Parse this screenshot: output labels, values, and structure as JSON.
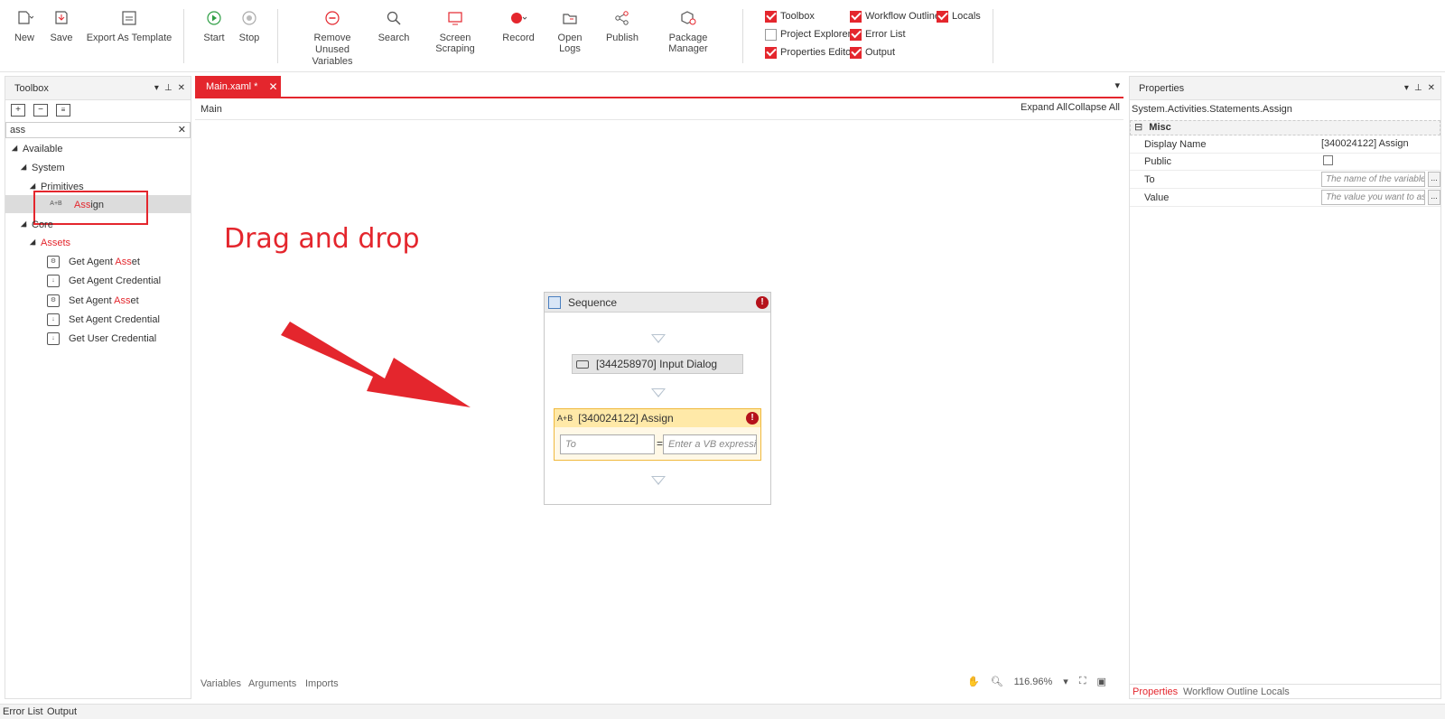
{
  "ribbon": {
    "buttons": [
      {
        "label": "New",
        "icon": "new-file-icon"
      },
      {
        "label": "Save",
        "icon": "save-icon"
      },
      {
        "label": "Export As Template",
        "icon": "export-template-icon"
      },
      {
        "label": "Start",
        "icon": "play-icon"
      },
      {
        "label": "Stop",
        "icon": "stop-icon"
      },
      {
        "label": "Remove Unused Variables",
        "icon": "remove-icon"
      },
      {
        "label": "Search",
        "icon": "search-icon"
      },
      {
        "label": "Screen Scraping",
        "icon": "screen-scraping-icon"
      },
      {
        "label": "Record",
        "icon": "record-icon"
      },
      {
        "label": "Open Logs",
        "icon": "open-logs-icon"
      },
      {
        "label": "Publish",
        "icon": "publish-icon"
      },
      {
        "label": "Package Manager",
        "icon": "package-manager-icon"
      }
    ],
    "remove_line1": "Remove Unused",
    "remove_line2": "Variables",
    "panels": [
      {
        "label": "Toolbox",
        "checked": true
      },
      {
        "label": "Project Explorer",
        "checked": false
      },
      {
        "label": "Properties Editor",
        "checked": true
      },
      {
        "label": "Workflow Outline",
        "checked": true
      },
      {
        "label": "Error List",
        "checked": true
      },
      {
        "label": "Output",
        "checked": true
      },
      {
        "label": "Locals",
        "checked": true
      }
    ]
  },
  "toolbox": {
    "title": "Toolbox",
    "search_value": "ass",
    "tree": {
      "available": "Available",
      "system": "System",
      "primitives": "Primitives",
      "assign_pre": "",
      "assign_hl": "Ass",
      "assign_post": "ign",
      "core": "Core",
      "assets_hl": "Assets",
      "items": [
        {
          "pre": "Get Agent ",
          "hl": "Ass",
          "post": "et"
        },
        {
          "pre": "Get Agent Credential",
          "hl": "",
          "post": ""
        },
        {
          "pre": "Set Agent ",
          "hl": "Ass",
          "post": "et"
        },
        {
          "pre": "Set Agent Credential",
          "hl": "",
          "post": ""
        },
        {
          "pre": "Get User Credential",
          "hl": "",
          "post": ""
        }
      ]
    }
  },
  "designer": {
    "tab": "Main.xaml *",
    "breadcrumb": "Main",
    "expand_all": "Expand All",
    "collapse_all": "Collapse All",
    "annotation": "Drag and drop",
    "sequence": {
      "title": "Sequence",
      "input_dialog": "[344258970] Input Dialog",
      "assign_title": "[340024122] Assign",
      "assign_icon": "A+B",
      "to_placeholder": "To",
      "value_placeholder": "Enter a VB expressi",
      "equals": "="
    },
    "bottom_tabs": [
      "Variables",
      "Arguments",
      "Imports"
    ],
    "zoom": "116.96%"
  },
  "properties": {
    "title": "Properties",
    "type": "System.Activities.Statements.Assign",
    "category": "Misc",
    "rows": {
      "display_name_label": "Display Name",
      "display_name_value": "[340024122] Assign",
      "public_label": "Public",
      "to_label": "To",
      "to_placeholder": "The name of the variable",
      "value_label": "Value",
      "value_placeholder": "The value you want to as"
    },
    "dots": "...",
    "bottom_tabs": [
      "Properties",
      "Workflow Outline",
      "Locals"
    ]
  },
  "statusbar": {
    "tabs": [
      "Error List",
      "Output"
    ]
  }
}
